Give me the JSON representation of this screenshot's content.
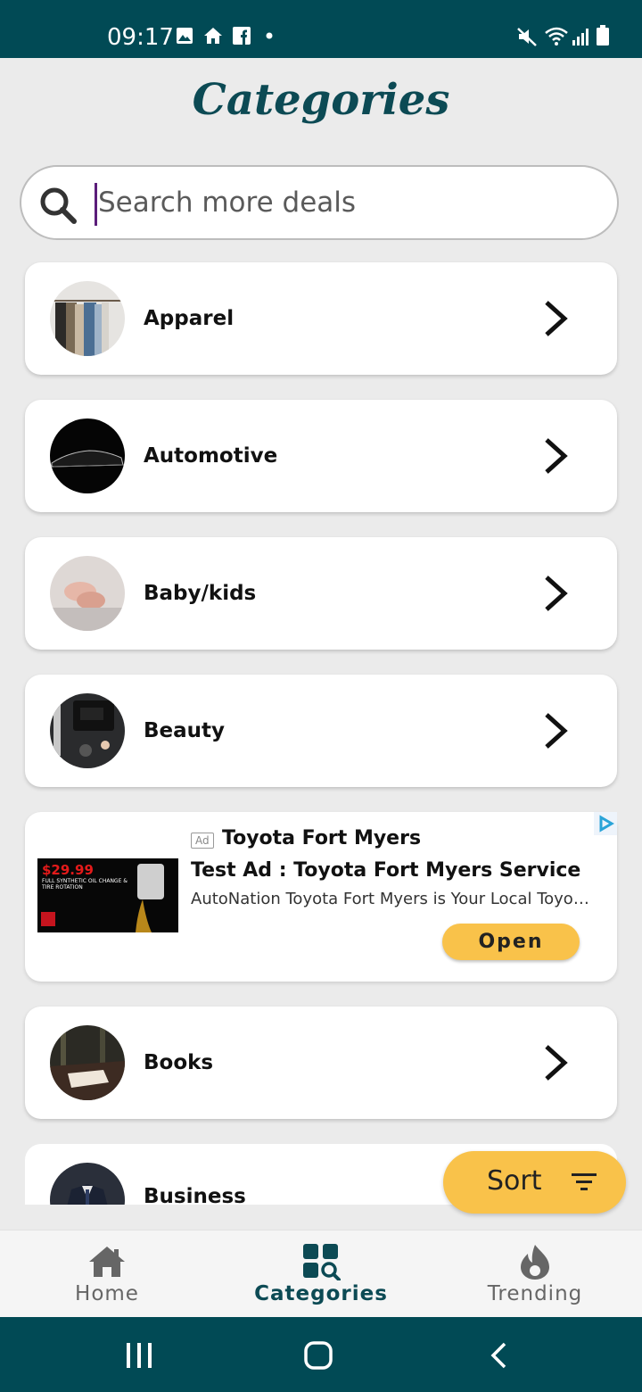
{
  "status_bar": {
    "time": "09:17",
    "icons": [
      "image-icon",
      "home-icon",
      "facebook-icon",
      "dot-icon",
      "mute-icon",
      "wifi-icon",
      "signal-icon",
      "battery-icon"
    ]
  },
  "header": {
    "title": "Categories"
  },
  "search": {
    "placeholder": "Search more deals",
    "value": ""
  },
  "categories": [
    {
      "label": "Apparel",
      "icon": "apparel-thumbnail"
    },
    {
      "label": "Automotive",
      "icon": "automotive-thumbnail"
    },
    {
      "label": "Baby/kids",
      "icon": "baby-kids-thumbnail"
    },
    {
      "label": "Beauty",
      "icon": "beauty-thumbnail"
    },
    {
      "label": "Books",
      "icon": "books-thumbnail"
    },
    {
      "label": "Business",
      "icon": "business-thumbnail"
    }
  ],
  "ad": {
    "badge": "Ad",
    "advertiser": "Toyota Fort Myers",
    "headline": "Test Ad : Toyota Fort Myers Service",
    "body": "AutoNation Toyota Fort Myers is Your Local Toyota Dealer",
    "cta": "Open",
    "image_price": "$29.99",
    "image_caption": "FULL SYNTHETIC OIL CHANGE & TIRE ROTATION"
  },
  "sort_button": {
    "label": "Sort"
  },
  "bottom_nav": {
    "items": [
      {
        "label": "Home",
        "icon": "home-icon",
        "active": false
      },
      {
        "label": "Categories",
        "icon": "categories-icon",
        "active": true
      },
      {
        "label": "Trending",
        "icon": "flame-icon",
        "active": false
      }
    ]
  },
  "colors": {
    "brand": "#014a55",
    "accent": "#f9c24a",
    "background": "#ebebeb"
  }
}
